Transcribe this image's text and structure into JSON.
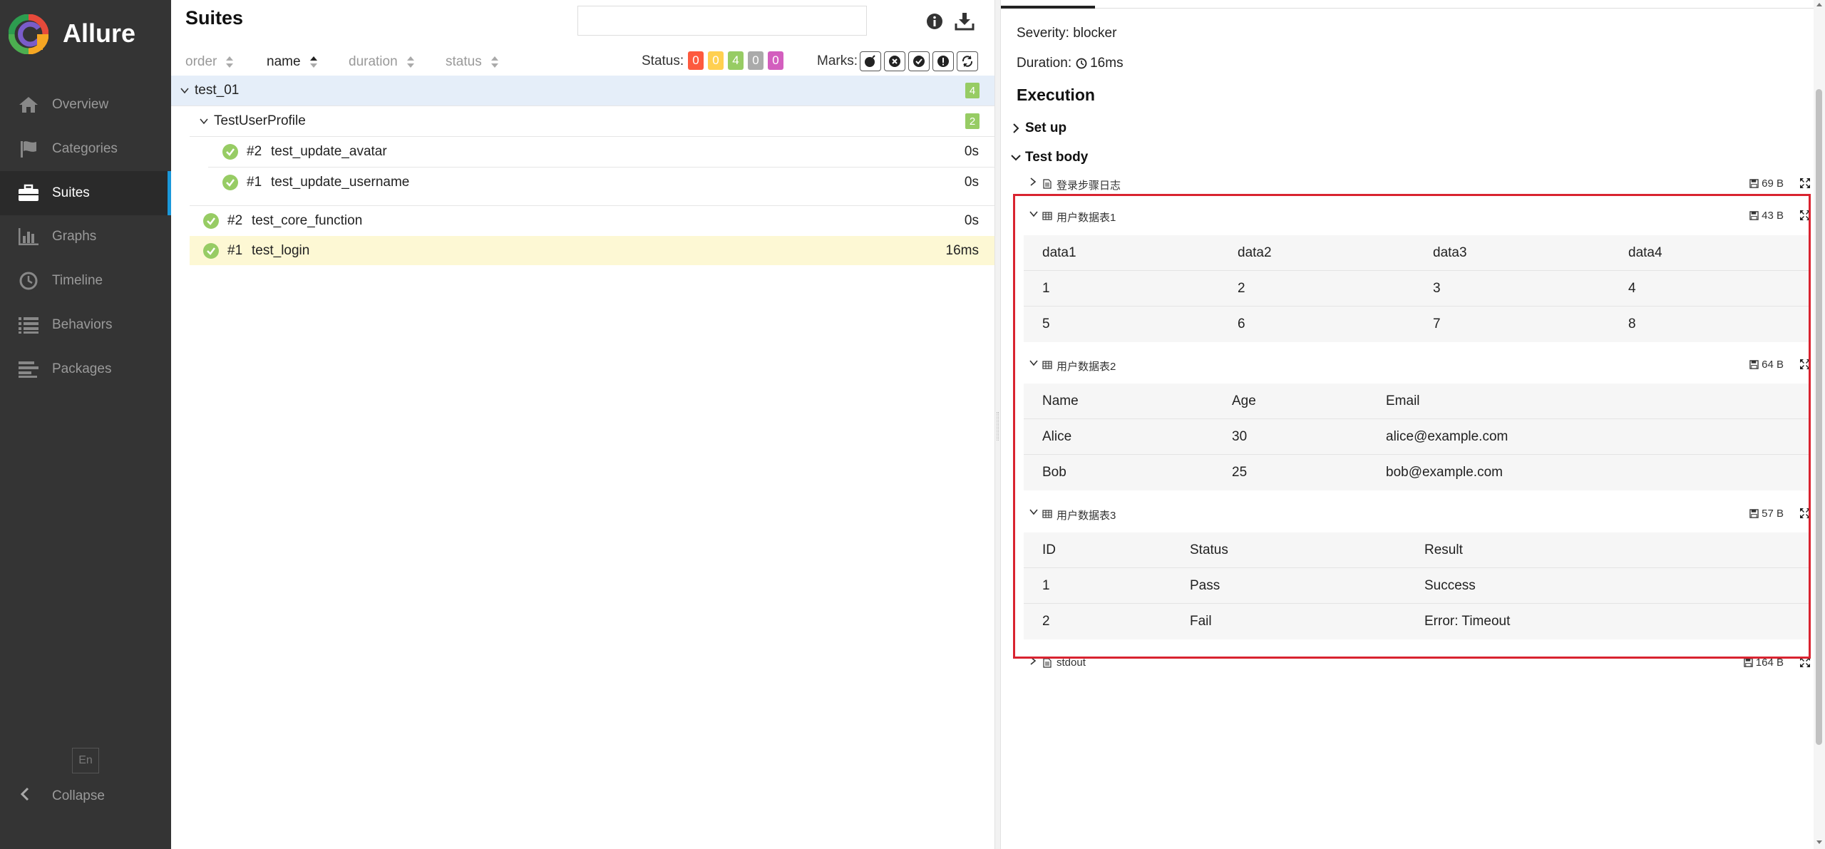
{
  "app": {
    "name": "Allure"
  },
  "sidebar": {
    "items": [
      {
        "label": "Overview",
        "icon": "home-icon",
        "active": false
      },
      {
        "label": "Categories",
        "icon": "flag-icon",
        "active": false
      },
      {
        "label": "Suites",
        "icon": "briefcase-icon",
        "active": true
      },
      {
        "label": "Graphs",
        "icon": "bar-chart-icon",
        "active": false
      },
      {
        "label": "Timeline",
        "icon": "clock-icon",
        "active": false
      },
      {
        "label": "Behaviors",
        "icon": "list-icon",
        "active": false
      },
      {
        "label": "Packages",
        "icon": "align-left-icon",
        "active": false
      }
    ],
    "language": "En",
    "collapse_label": "Collapse"
  },
  "suites": {
    "title": "Suites",
    "search_placeholder": "",
    "sort": {
      "order": "order",
      "name": "name",
      "duration": "duration",
      "status": "status"
    },
    "status_label": "Status:",
    "status_counts": [
      {
        "value": "0",
        "color": "#fd5a3e"
      },
      {
        "value": "0",
        "color": "#ffd050"
      },
      {
        "value": "4",
        "color": "#97cc64"
      },
      {
        "value": "0",
        "color": "#aaaaaa"
      },
      {
        "value": "0",
        "color": "#d35ebe"
      }
    ],
    "marks_label": "Marks:",
    "tree": {
      "root": {
        "name": "test_01",
        "count": "4"
      },
      "group": {
        "name": "TestUserProfile",
        "count": "2"
      },
      "group_items": [
        {
          "num": "#2",
          "name": "test_update_avatar",
          "duration": "0s"
        },
        {
          "num": "#1",
          "name": "test_update_username",
          "duration": "0s"
        }
      ],
      "items": [
        {
          "num": "#2",
          "name": "test_core_function",
          "duration": "0s"
        },
        {
          "num": "#1",
          "name": "test_login",
          "duration": "16ms"
        }
      ]
    }
  },
  "detail": {
    "severity": "Severity: blocker",
    "duration": "16ms",
    "duration_label": "Duration:",
    "execution_title": "Execution",
    "setup_label": "Set up",
    "body_label": "Test body",
    "attachments": [
      {
        "name": "登录步骤日志",
        "size": "69 B"
      },
      {
        "name": "用户数据表1",
        "size": "43 B"
      },
      {
        "name": "用户数据表2",
        "size": "64 B"
      },
      {
        "name": "用户数据表3",
        "size": "57 B"
      },
      {
        "name": "stdout",
        "size": "164 B"
      }
    ],
    "table1": {
      "headers": [
        "data1",
        "data2",
        "data3",
        "data4"
      ],
      "rows": [
        [
          "1",
          "2",
          "3",
          "4"
        ],
        [
          "5",
          "6",
          "7",
          "8"
        ]
      ]
    },
    "table2": {
      "headers": [
        "Name",
        "Age",
        "Email"
      ],
      "rows": [
        [
          "Alice",
          "30",
          "alice@example.com"
        ],
        [
          "Bob",
          "25",
          "bob@example.com"
        ]
      ]
    },
    "table3": {
      "headers": [
        "ID",
        "Status",
        "Result"
      ],
      "rows": [
        [
          "1",
          "Pass",
          "Success"
        ],
        [
          "2",
          "Fail",
          "Error: Timeout"
        ]
      ]
    }
  }
}
